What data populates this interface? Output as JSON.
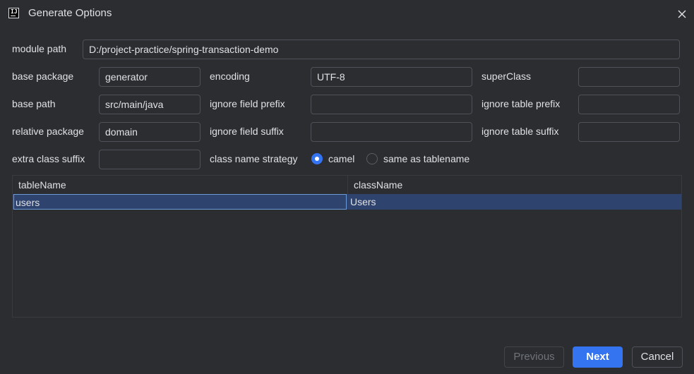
{
  "window": {
    "title": "Generate Options",
    "app_icon_text": "IJ"
  },
  "form": {
    "module_path": {
      "label": "module path",
      "value": "D:/project-practice/spring-transaction-demo"
    },
    "base_package": {
      "label": "base package",
      "value": "generator"
    },
    "base_path": {
      "label": "base path",
      "value": "src/main/java"
    },
    "relative_package": {
      "label": "relative package",
      "value": "domain"
    },
    "extra_class_suffix": {
      "label": "extra class suffix",
      "value": ""
    },
    "encoding": {
      "label": "encoding",
      "value": "UTF-8"
    },
    "ignore_field_prefix": {
      "label": "ignore field prefix",
      "value": ""
    },
    "ignore_field_suffix": {
      "label": "ignore field suffix",
      "value": ""
    },
    "super_class": {
      "label": "superClass",
      "value": ""
    },
    "ignore_table_prefix": {
      "label": "ignore table prefix",
      "value": ""
    },
    "ignore_table_suffix": {
      "label": "ignore table suffix",
      "value": ""
    },
    "class_name_strategy": {
      "label": "class name strategy",
      "options": [
        "camel",
        "same as tablename"
      ],
      "selected": "camel"
    }
  },
  "table": {
    "columns": [
      "tableName",
      "className"
    ],
    "rows": [
      {
        "tableName": "users",
        "className": "Users"
      }
    ]
  },
  "buttons": {
    "previous": "Previous",
    "next": "Next",
    "cancel": "Cancel"
  },
  "colors": {
    "background": "#2b2d30",
    "accent": "#3574f0",
    "selection": "#2e436e",
    "border": "#4e5157"
  }
}
